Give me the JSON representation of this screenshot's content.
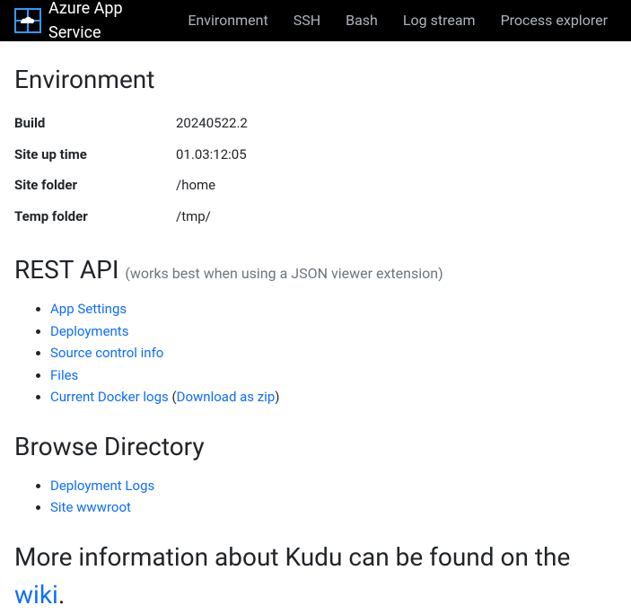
{
  "navbar": {
    "brand": "Azure App Service",
    "items": [
      {
        "label": "Environment"
      },
      {
        "label": "SSH"
      },
      {
        "label": "Bash"
      },
      {
        "label": "Log stream"
      },
      {
        "label": "Process explorer"
      }
    ]
  },
  "environment": {
    "heading": "Environment",
    "rows": [
      {
        "key": "Build",
        "val": "20240522.2"
      },
      {
        "key": "Site up time",
        "val": "01.03:12:05"
      },
      {
        "key": "Site folder",
        "val": "/home"
      },
      {
        "key": "Temp folder",
        "val": "/tmp/"
      }
    ]
  },
  "restapi": {
    "heading": "REST API ",
    "hint": "(works best when using a JSON viewer extension)",
    "links": {
      "app_settings": "App Settings",
      "deployments": "Deployments",
      "source_control": "Source control info",
      "files": "Files",
      "docker_logs": "Current Docker logs",
      "download_zip": "Download as zip"
    }
  },
  "browse": {
    "heading": "Browse Directory",
    "links": {
      "deployment_logs": "Deployment Logs",
      "site_wwwroot": "Site wwwroot"
    }
  },
  "more_info": {
    "prefix": "More information about Kudu can be found on the ",
    "link": "wiki",
    "suffix": "."
  }
}
